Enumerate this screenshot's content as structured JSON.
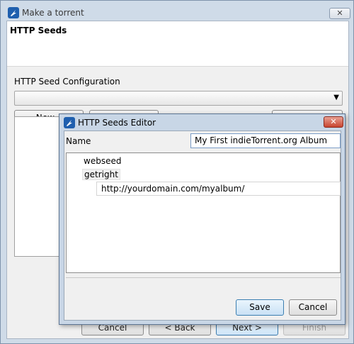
{
  "window": {
    "title": "Make a torrent",
    "close_glyph": "✕",
    "step_title": "HTTP Seeds"
  },
  "config": {
    "label": "HTTP Seed Configuration",
    "select_value": "",
    "dropdown_glyph": "▼"
  },
  "buttons": {
    "new_label": "New...",
    "cancel_label": "Cancel",
    "back_label": "< Back",
    "next_label": "Next >",
    "finish_label": "Finish"
  },
  "dialog": {
    "title": "HTTP Seeds Editor",
    "close_glyph": "✕",
    "name_label": "Name",
    "name_value": "My First indieTorrent.org Album",
    "tree": {
      "node1": "webseed",
      "node2": "getright",
      "url_value": "http://yourdomain.com/myalbum/"
    },
    "save_label": "Save",
    "cancel_label": "Cancel"
  },
  "colors": {
    "accent": "#3c7fb1",
    "close_red": "#c8442f",
    "frame": "#cfdbe8"
  }
}
